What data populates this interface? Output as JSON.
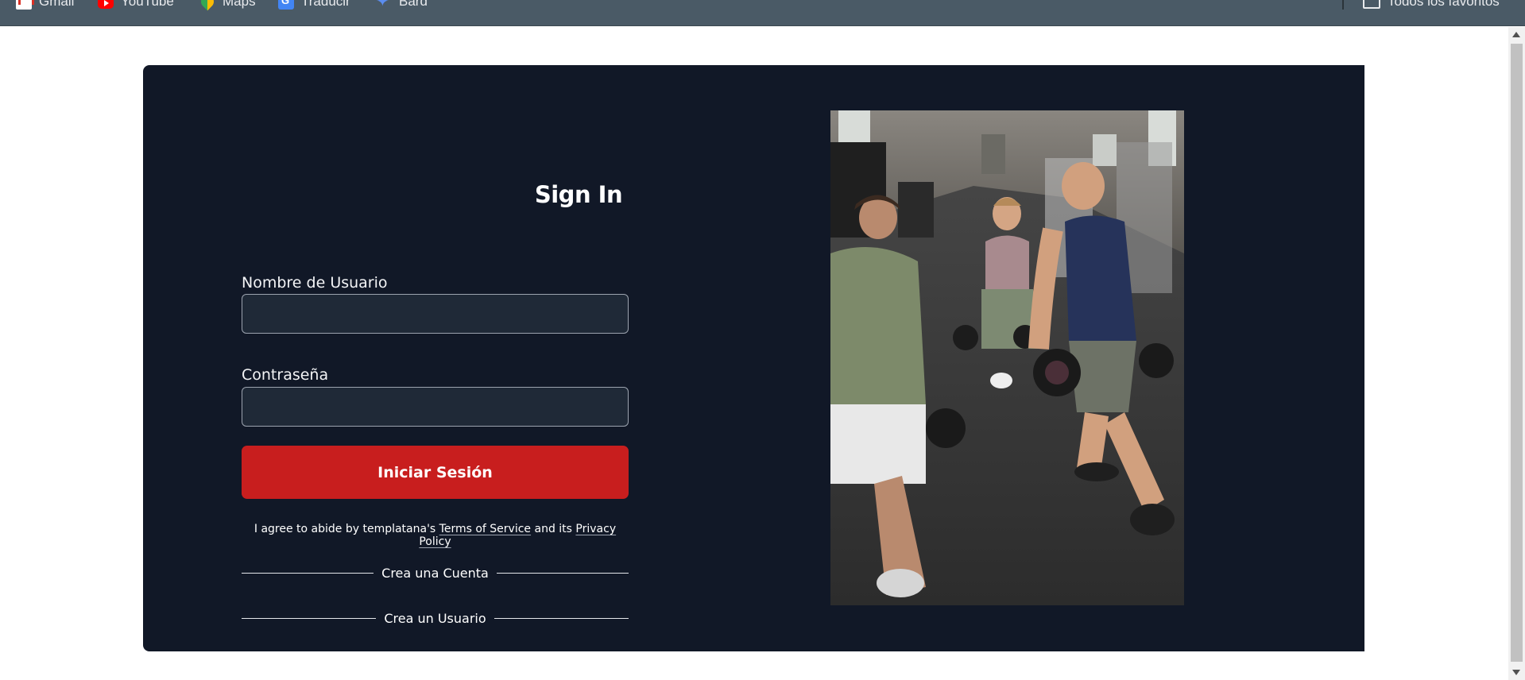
{
  "bookmarks": {
    "items": [
      {
        "label": "Gmail",
        "icon": "gmail-icon"
      },
      {
        "label": "YouTube",
        "icon": "youtube-icon"
      },
      {
        "label": "Maps",
        "icon": "maps-icon"
      },
      {
        "label": "Traducir",
        "icon": "translate-icon"
      },
      {
        "label": "Bard",
        "icon": "bard-icon"
      }
    ],
    "all_bookmarks": "Todos los favoritos"
  },
  "login": {
    "title": "Sign In",
    "username_label": "Nombre de Usuario",
    "username_value": "",
    "password_label": "Contraseña",
    "password_value": "",
    "submit_label": "Iniciar Sesión",
    "terms_prefix": "I agree to abide by templatana's ",
    "terms_link": "Terms of Service",
    "terms_middle": " and its ",
    "privacy_link": "Privacy Policy",
    "create_account": "Crea una Cuenta",
    "create_user": "Crea un Usuario"
  },
  "colors": {
    "card_bg": "#111827",
    "input_bg": "#1f2937",
    "accent": "#c81e1e",
    "bookmarks_bg": "#4a5a66"
  }
}
